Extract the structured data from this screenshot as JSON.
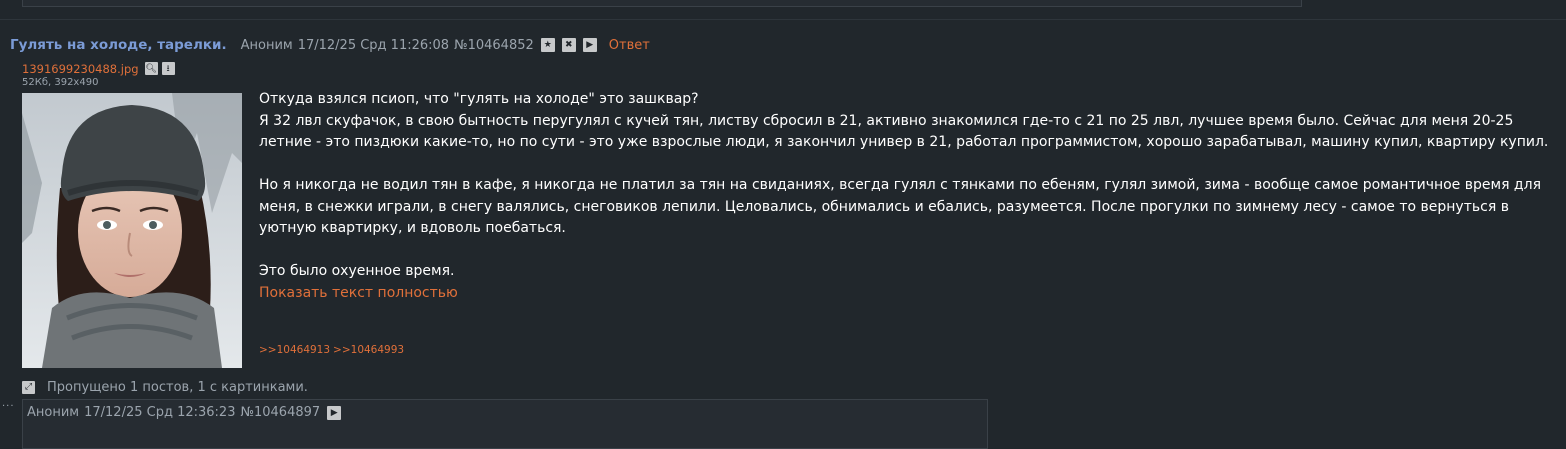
{
  "thread": {
    "subject": "Гулять на холоде, тарелки.",
    "author": "Аноним",
    "datetime": "17/12/25 Срд 11:26:08",
    "post_number": "№10464852",
    "reply_label": "Ответ",
    "file": {
      "name": "1391699230488.jpg",
      "meta": "52Кб, 392x490"
    },
    "body": {
      "line1": "Откуда взялся псиоп, что \"гулять на холоде\" это зашквар?",
      "para1": "Я 32 лвл скуфачок, в свою бытность перугулял с кучей тян, листву сбросил в 21, активно знакомился где-то с 21 по 25 лвл, лучшее время было. Сейчас для меня 20-25 летние - это пиздюки какие-то, но по сути - это уже взрослые люди, я закончил универ в 21, работал программистом, хорошо зарабатывал, машину купил, квартиру купил.",
      "para2": "Но я никогда не водил тян в кафе, я никогда не платил за тян на свиданиях, всегда гулял с тянками по ебеням, гулял зимой, зима - вообще самое романтичное время для меня, в снежки играли, в снегу валялись, снеговиков лепили. Целовались, обнимались и ебались, разумеется. После прогулки по зимнему лесу - самое то вернуться в уютную квартирку, и вдоволь поебаться.",
      "para3": "Это было охуенное время.",
      "show_full": "Показать текст полностью"
    },
    "replies": [
      ">>10464913",
      ">>10464993"
    ]
  },
  "skipped": {
    "text": "Пропущено 1 постов, 1 с картинками."
  },
  "reply_post": {
    "author": "Аноним",
    "datetime": "17/12/25 Срд 12:36:23",
    "post_number": "№10464897"
  },
  "icons": {
    "star": "star-icon",
    "hide": "close-icon",
    "play": "play-icon",
    "search": "search-icon",
    "download": "download-icon",
    "expand": "expand-icon"
  },
  "colors": {
    "background": "#21272c",
    "subject": "#7b9bd6",
    "link": "#e0703a",
    "meta": "#9ba4ad",
    "text": "#ffffff"
  }
}
